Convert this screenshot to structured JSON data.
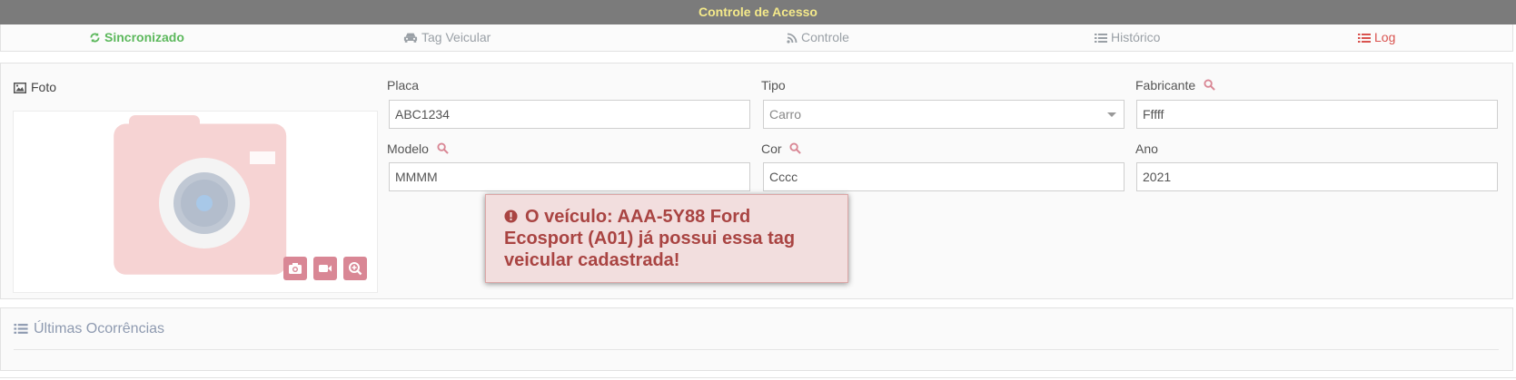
{
  "title": "Controle de Acesso",
  "nav": {
    "sync": {
      "label": "Sincronizado",
      "icon": "refresh-icon"
    },
    "tag": {
      "label": "Tag Veicular",
      "icon": "car-icon"
    },
    "controle": {
      "label": "Controle",
      "icon": "rss-icon"
    },
    "historico": {
      "label": "Histórico",
      "icon": "list-icon"
    },
    "log": {
      "label": "Log",
      "icon": "list-icon"
    }
  },
  "foto": {
    "label": "Foto",
    "icon": "image-icon",
    "buttons": [
      "camera-icon",
      "video-icon",
      "zoom-in-icon"
    ]
  },
  "form": {
    "placa": {
      "label": "Placa",
      "value": "ABC1234"
    },
    "tipo": {
      "label": "Tipo",
      "value": "Carro"
    },
    "fabricante": {
      "label": "Fabricante",
      "value": "Fffff"
    },
    "modelo": {
      "label": "Modelo",
      "value": "MMMM"
    },
    "cor": {
      "label": "Cor",
      "value": "Cccc"
    },
    "ano": {
      "label": "Ano",
      "value": "2021"
    }
  },
  "alert": {
    "message": "O veículo: AAA-5Y88 Ford Ecosport (A01) já possui essa tag veicular cadastrada!",
    "icon": "exclamation-circle-icon"
  },
  "ocorrencias": {
    "title": "Últimas Ocorrências",
    "icon": "list-icon"
  },
  "colors": {
    "titlebar_bg": "#7b7b7b",
    "titlebar_text": "#f4e98a",
    "success": "#5cb85c",
    "danger": "#d9534f",
    "accent_pink": "#d98795",
    "alert_bg": "#f2dede",
    "alert_text": "#a94442"
  }
}
